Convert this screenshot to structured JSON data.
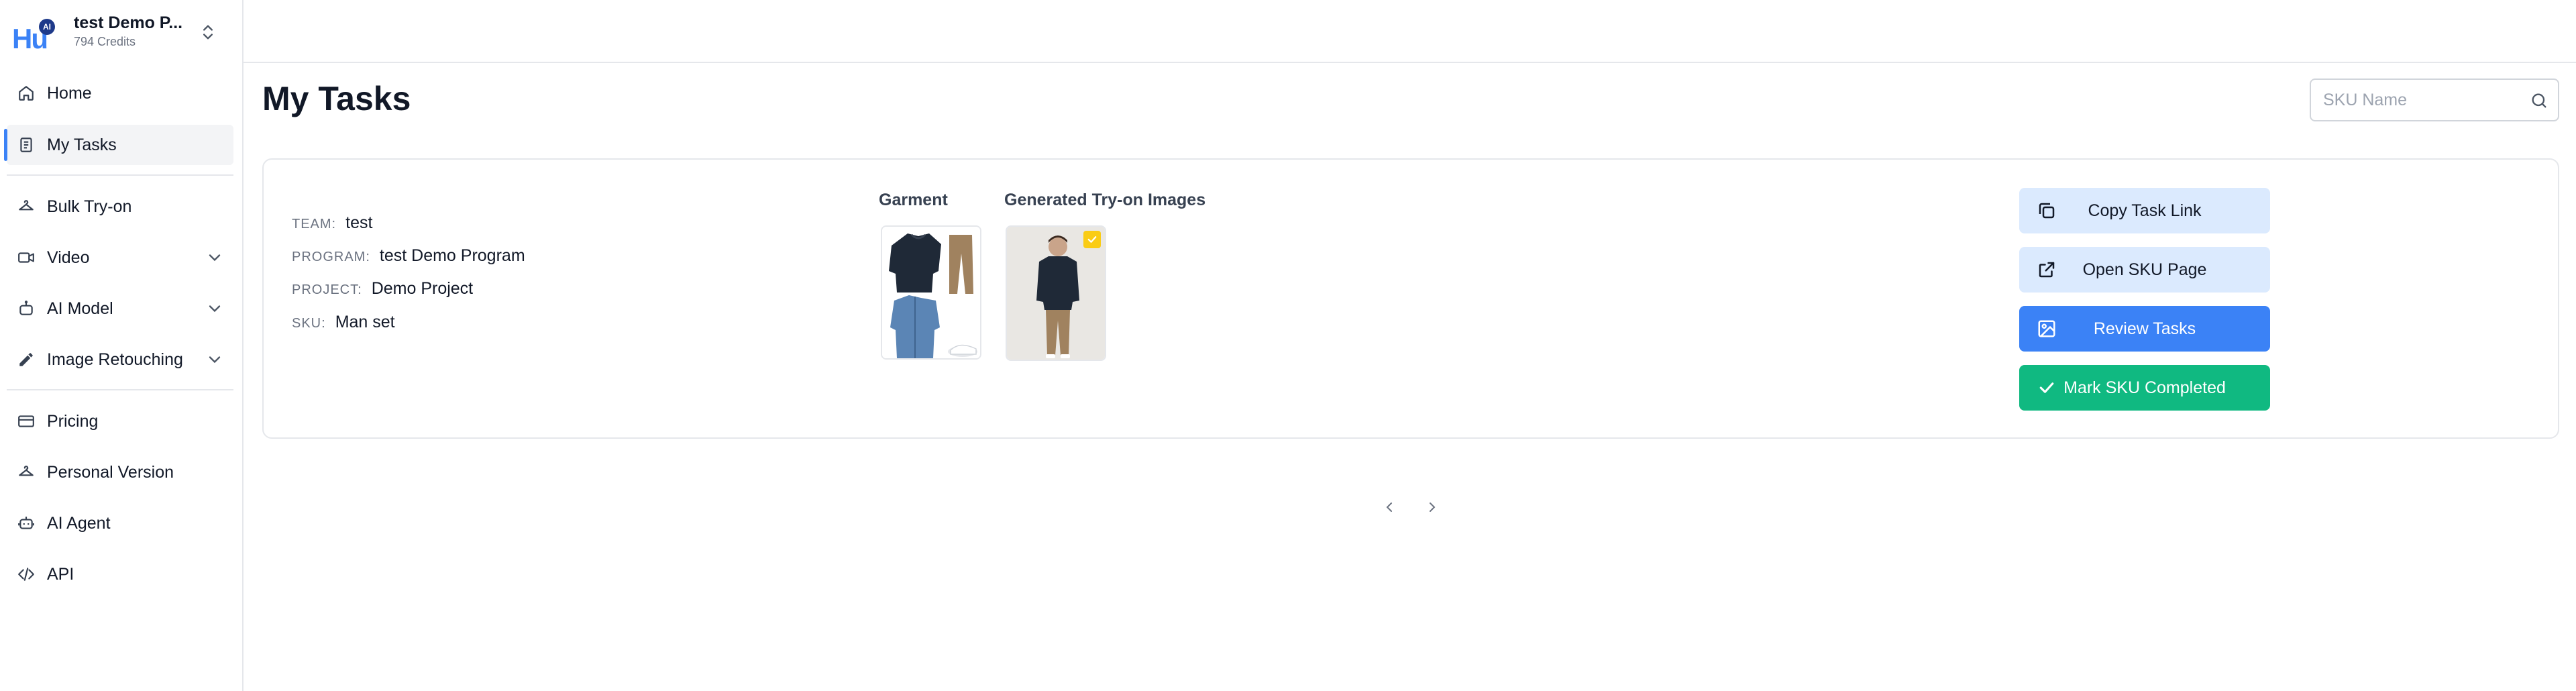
{
  "sidebar": {
    "logo_text": "Hu",
    "logo_badge": "AI",
    "org_name": "test Demo P...",
    "org_credits": "794 Credits",
    "items": [
      {
        "label": "Home",
        "icon": "home-icon"
      },
      {
        "label": "My Tasks",
        "icon": "clipboard-icon",
        "active": true
      },
      {
        "label": "Bulk Try-on",
        "icon": "hanger-icon"
      },
      {
        "label": "Video",
        "icon": "video-icon",
        "expandable": true
      },
      {
        "label": "AI Model",
        "icon": "robot-icon",
        "expandable": true
      },
      {
        "label": "Image Retouching",
        "icon": "pencil-icon",
        "expandable": true
      },
      {
        "label": "Pricing",
        "icon": "card-icon"
      },
      {
        "label": "Personal Version",
        "icon": "hanger-icon"
      },
      {
        "label": "AI Agent",
        "icon": "bot-icon"
      },
      {
        "label": "API",
        "icon": "code-icon"
      }
    ]
  },
  "main": {
    "title": "My Tasks",
    "search": {
      "placeholder": "SKU Name",
      "value": ""
    }
  },
  "task": {
    "team_key": "TEAM:",
    "team": "test",
    "program_key": "PROGRAM:",
    "program": "test Demo Program",
    "project_key": "PROJECT:",
    "project": "Demo Project",
    "sku_key": "SKU:",
    "sku": "Man set",
    "garment_label": "Garment",
    "generated_label": "Generated Try-on Images",
    "actions": {
      "copy": "Copy Task Link",
      "open": "Open SKU Page",
      "review": "Review Tasks",
      "complete": "Mark SKU Completed"
    }
  },
  "colors": {
    "accent": "#3b82f6",
    "accent_light": "#dbeafe",
    "success": "#10b981",
    "badge": "#facc15"
  }
}
